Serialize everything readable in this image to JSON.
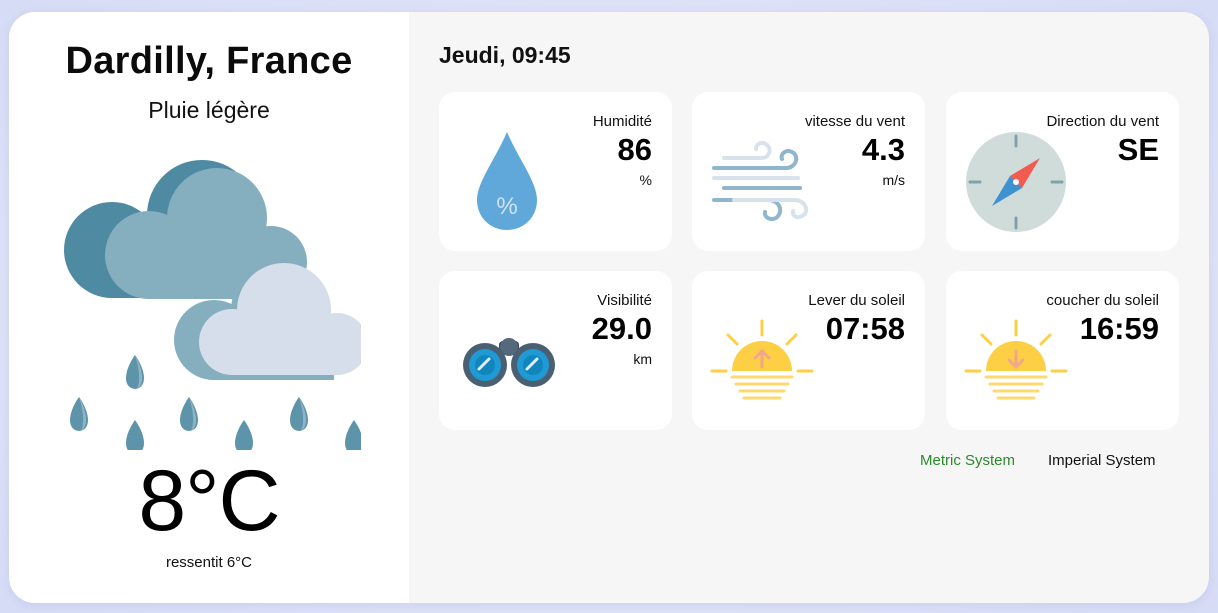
{
  "location": {
    "city": "Dardilly, France",
    "description": "Pluie légère"
  },
  "current": {
    "temperature": "8°C",
    "feels_like_label": "ressentit",
    "feels_like_value": "6°C"
  },
  "datetime": "Jeudi, 09:45",
  "cards": {
    "humidity": {
      "title": "Humidité",
      "value": "86",
      "unit": "%",
      "icon": "humidity-drop-icon"
    },
    "wind_speed": {
      "title": "vitesse du vent",
      "value": "4.3",
      "unit": "m/s",
      "icon": "wind-icon"
    },
    "wind_direction": {
      "title": "Direction du vent",
      "value": "SE",
      "icon": "compass-icon"
    },
    "visibility": {
      "title": "Visibilité",
      "value": "29.0",
      "unit": "km",
      "icon": "binoculars-icon"
    },
    "sunrise": {
      "title": "Lever du soleil",
      "value": "07:58",
      "icon": "sunrise-icon"
    },
    "sunset": {
      "title": "coucher du soleil",
      "value": "16:59",
      "icon": "sunset-icon"
    }
  },
  "units": {
    "metric": "Metric System",
    "imperial": "Imperial System",
    "active": "metric"
  },
  "colors": {
    "active_unit": "#2a8a2a",
    "panel": "#f6f6f6",
    "card": "#ffffff"
  },
  "weather_icon": "cloud-rain-icon"
}
